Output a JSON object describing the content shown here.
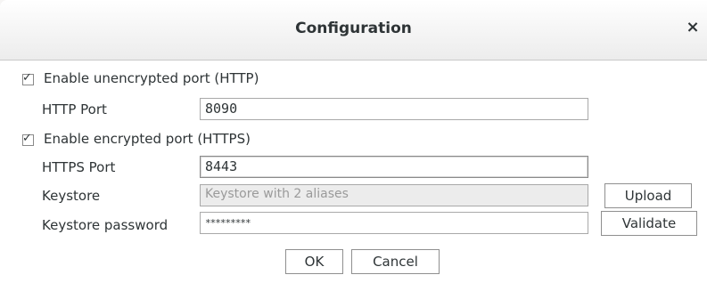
{
  "window": {
    "title": "Configuration",
    "close_glyph": "×"
  },
  "http": {
    "enable_label": "Enable unencrypted port (HTTP)",
    "enabled": true,
    "port_label": "HTTP Port",
    "port_value": "8090"
  },
  "https": {
    "enable_label": "Enable encrypted port (HTTPS)",
    "enabled": true,
    "port_label": "HTTPS Port",
    "port_value": "8443",
    "keystore_label": "Keystore",
    "keystore_placeholder": "Keystore with 2 aliases",
    "keystore_password_label": "Keystore password",
    "keystore_password_value": "*********",
    "upload_label": "Upload",
    "validate_label": "Validate"
  },
  "checkmark": "✓",
  "footer": {
    "ok_label": "OK",
    "cancel_label": "Cancel"
  }
}
